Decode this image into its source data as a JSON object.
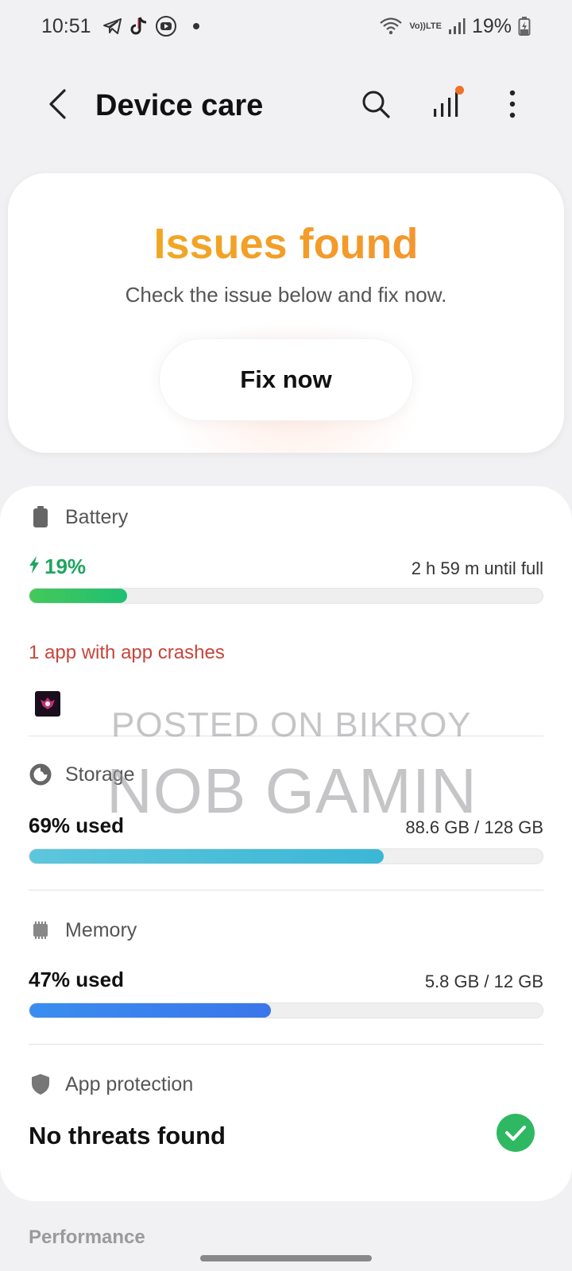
{
  "status_bar": {
    "time": "10:51",
    "volte_top": "Vo))",
    "volte_bottom": "LTE",
    "battery_percent": "19%",
    "icons": [
      "telegram-icon",
      "tiktok-icon",
      "youtube-icon",
      "dot-icon",
      "wifi-icon",
      "volte-icon",
      "signal-icon",
      "battery-charging-icon"
    ]
  },
  "app_bar": {
    "title": "Device care",
    "icons": [
      "back-icon",
      "search-icon",
      "signal-bars-icon",
      "more-icon"
    ],
    "notification_dot_color": "#f07226"
  },
  "hero": {
    "title": "Issues found",
    "subtitle": "Check the issue below and fix now.",
    "button": "Fix now",
    "title_color": "#f0b11f"
  },
  "battery": {
    "label": "Battery",
    "value": "19%",
    "detail": "2 h 59 m until full",
    "fill_fraction": 0.19,
    "color": "#2ec46b",
    "issue": "1 app with app crashes"
  },
  "storage": {
    "label": "Storage",
    "value": "69% used",
    "detail": "88.6 GB / 128 GB",
    "fill_fraction": 0.69,
    "color": "#4bbedb"
  },
  "memory": {
    "label": "Memory",
    "value": "47% used",
    "detail": "5.8 GB / 12 GB",
    "fill_fraction": 0.47,
    "color": "#3b86f0"
  },
  "app_protection": {
    "label": "App protection",
    "status": "No threats found",
    "status_color": "#2fb862"
  },
  "performance": {
    "label": "Performance"
  },
  "watermark": {
    "line1": "POSTED ON BIKROY",
    "line2": "NOB GAMIN"
  }
}
